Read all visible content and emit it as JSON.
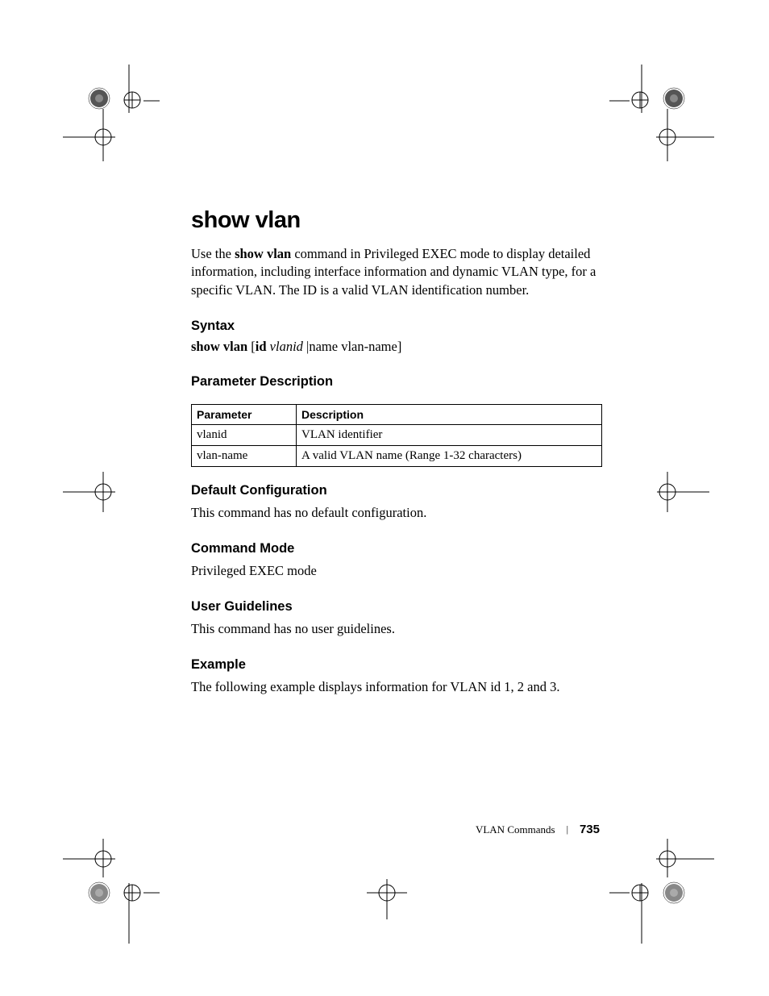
{
  "heading": "show vlan",
  "description_prefix": "Use the ",
  "description_bold": "show vlan",
  "description_suffix": " command in Privileged EXEC mode to display detailed information, including interface information and dynamic VLAN type, for a specific VLAN. The ID is a valid VLAN identification number.",
  "sections": {
    "syntax": {
      "heading": "Syntax",
      "cmd_bold1": "show vlan",
      "cmd_bracket_open": " [",
      "cmd_bold2": "id",
      "cmd_space": " ",
      "cmd_italic": "vlanid",
      "cmd_tail": " |name vlan-name]"
    },
    "param_desc": {
      "heading": "Parameter Description",
      "table": {
        "headers": [
          "Parameter",
          "Description"
        ],
        "rows": [
          [
            "vlanid",
            "VLAN identifier"
          ],
          [
            "vlan-name",
            "A valid VLAN name (Range 1-32 characters)"
          ]
        ]
      }
    },
    "default_config": {
      "heading": "Default Configuration",
      "body": "This command has no default configuration."
    },
    "command_mode": {
      "heading": "Command Mode",
      "body": "Privileged EXEC mode"
    },
    "user_guidelines": {
      "heading": "User Guidelines",
      "body": "This command has no user guidelines."
    },
    "example": {
      "heading": "Example",
      "body": "The following example displays information for VLAN id 1, 2 and 3."
    }
  },
  "footer": {
    "section": "VLAN Commands",
    "page": "735"
  }
}
